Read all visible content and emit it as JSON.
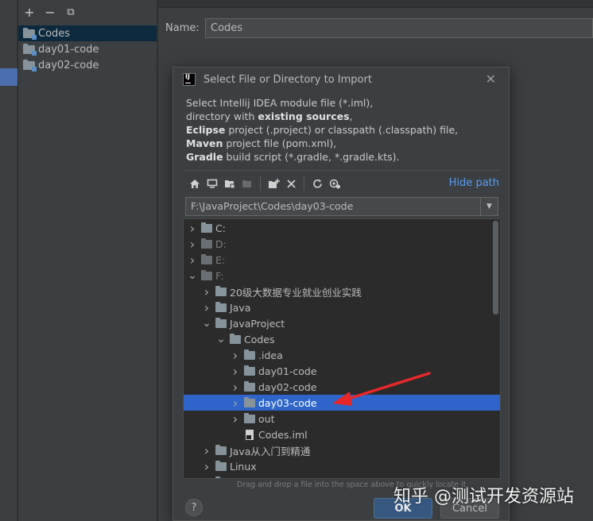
{
  "module_panel": {
    "toolbar": {
      "add": "+",
      "remove": "−",
      "copy": "⧉"
    },
    "items": [
      {
        "label": "Codes"
      },
      {
        "label": "day01-code"
      },
      {
        "label": "day02-code"
      }
    ]
  },
  "right": {
    "name_label": "Name:",
    "name_value": "Codes"
  },
  "dialog": {
    "logo_text": "IJ",
    "title": "Select File or Directory to Import",
    "close": "✕",
    "desc": {
      "line1": "Select Intellij IDEA module file (*.iml),",
      "line2_a": "directory with ",
      "line2_b": "existing sources",
      "line2_c": ",",
      "line3_a": "Eclipse",
      "line3_b": " project (.project) or classpath (.classpath) file,",
      "line4_a": "Maven",
      "line4_b": " project file (pom.xml),",
      "line5_a": "Gradle",
      "line5_b": " build script (*.gradle, *.gradle.kts)."
    },
    "toolbar_icons": [
      "home-icon",
      "desktop-icon",
      "project-folder-icon",
      "module-folder-icon",
      "new-folder-icon",
      "delete-icon",
      "refresh-icon",
      "show-hidden-icon"
    ],
    "hide_path": "Hide path",
    "path": "F:\\JavaProject\\Codes\\day03-code",
    "tree": [
      {
        "label": "C:",
        "chev": ">"
      },
      {
        "label": "D:",
        "chev": ">"
      },
      {
        "label": "E:",
        "chev": ">"
      },
      {
        "label": "F:",
        "chev": "v"
      },
      {
        "label": "20级大数据专业就业创业实践",
        "chev": ">"
      },
      {
        "label": "Java",
        "chev": ">"
      },
      {
        "label": "JavaProject",
        "chev": "v"
      },
      {
        "label": "Codes",
        "chev": "v"
      },
      {
        "label": ".idea",
        "chev": ">"
      },
      {
        "label": "day01-code",
        "chev": ">"
      },
      {
        "label": "day02-code",
        "chev": ">"
      },
      {
        "label": "day03-code",
        "chev": ">"
      },
      {
        "label": "out",
        "chev": ">"
      },
      {
        "label": "Codes.iml",
        "chev": ""
      },
      {
        "label": "Java从入门到精通",
        "chev": ">"
      },
      {
        "label": "Linux",
        "chev": ">"
      },
      {
        "label": "",
        "chev": ">"
      }
    ],
    "hint": "Drag and drop a file into the space above to quickly locate it",
    "help": "?",
    "ok": "OK",
    "cancel": "Cancel"
  },
  "watermark": "知乎 @测试开发资源站",
  "colors": {
    "selection": "#2f65ca",
    "accent_link": "#589df6",
    "arrow": "#e8272a"
  }
}
